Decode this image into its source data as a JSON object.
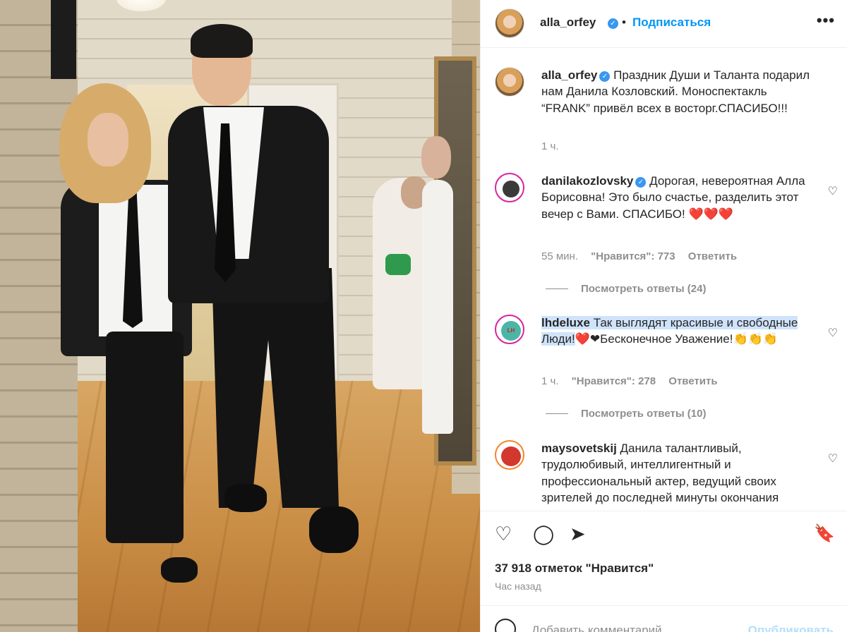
{
  "post": {
    "author": "alla_orfey",
    "follow_label": "Подписаться",
    "more_label": "•••",
    "caption": "Праздник Души и Таланта подарил нам Данила Козловский. Моноспектакль “FRANK” привёл всех в восторг.СПАСИБО!!!",
    "caption_time": "1 ч."
  },
  "comments": [
    {
      "user": "danilakozlovsky",
      "verified": true,
      "text": "Дорогая, невероятная Алла Борисовна! Это было счастье, разделить этот вечер с Вами. СПАСИБО! ❤️❤️❤️",
      "time": "55 мин.",
      "likes": "\"Нравится\": 773",
      "reply": "Ответить",
      "view_replies": "Посмотреть ответы (24)"
    },
    {
      "user": "lhdeluxe",
      "text_highlighted": "Так выглядят красивые и свободные Люди!",
      "text_rest": "❤️❤Бесконечное Уважение!👏👏👏",
      "time": "1 ч.",
      "likes": "\"Нравится\": 278",
      "reply": "Ответить",
      "view_replies": "Посмотреть ответы (10)"
    },
    {
      "user": "maysovetskij",
      "text": "Данила талантливый, трудолюбивый, интеллигентный и профессиональный актер, ведущий своих зрителей до последней минуты окончания"
    }
  ],
  "footer": {
    "likes": "37 918 отметок \"Нравится\"",
    "time": "Час назад",
    "add_comment_placeholder": "Добавить комментарий...",
    "publish_label": "Опубликовать"
  },
  "icons": {
    "verified": "✓",
    "like": "♡",
    "comment": "◯",
    "share": "➤",
    "save": "🔖"
  },
  "colors": {
    "link": "#0095f6",
    "verified": "#3897f0",
    "muted": "#8e8e8e",
    "highlight": "#cfe3fb"
  }
}
